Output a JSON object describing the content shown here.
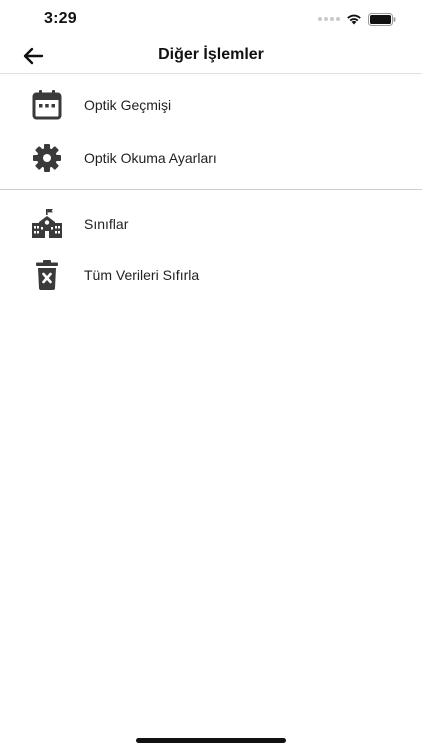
{
  "status_bar": {
    "time": "3:29"
  },
  "nav": {
    "title": "Diğer İşlemler",
    "back_icon": "arrow-left-icon"
  },
  "menu": {
    "group1": [
      {
        "label": "Optik Geçmişi",
        "icon": "calendar-icon"
      },
      {
        "label": "Optik Okuma Ayarları",
        "icon": "gear-icon"
      }
    ],
    "group2": [
      {
        "label": "Sınıflar",
        "icon": "school-icon"
      },
      {
        "label": "Tüm Verileri Sıfırla",
        "icon": "trash-x-icon"
      }
    ]
  },
  "colors": {
    "icon": "#3a3a3a",
    "text": "#222222",
    "divider": "#cfcfcf",
    "background": "#ffffff"
  }
}
